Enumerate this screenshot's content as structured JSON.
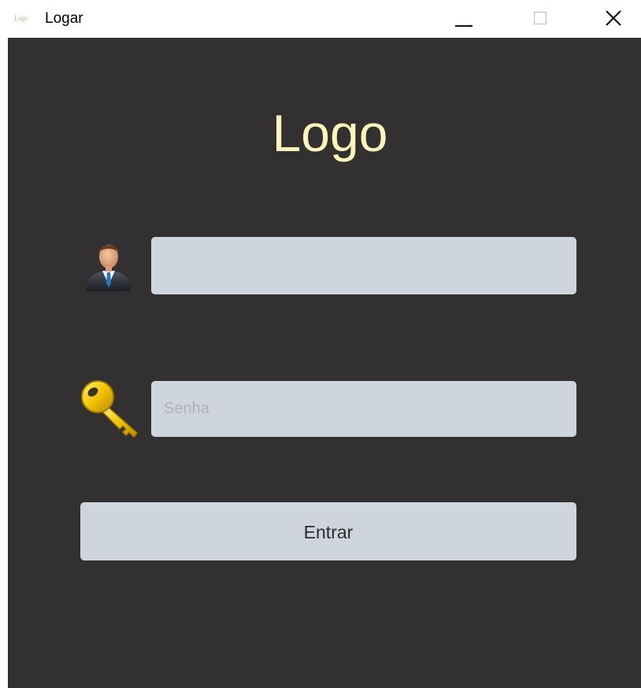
{
  "window": {
    "title": "Logar",
    "app_icon_text": "Logo"
  },
  "main": {
    "logo_text": "Logo",
    "username": {
      "value": "",
      "placeholder": "",
      "icon": "user-icon"
    },
    "password": {
      "value": "",
      "placeholder": "Senha",
      "icon": "key-icon"
    },
    "submit_label": "Entrar"
  },
  "colors": {
    "background": "#323030",
    "logo": "#fdf6b8",
    "field": "#cfd5dc"
  }
}
